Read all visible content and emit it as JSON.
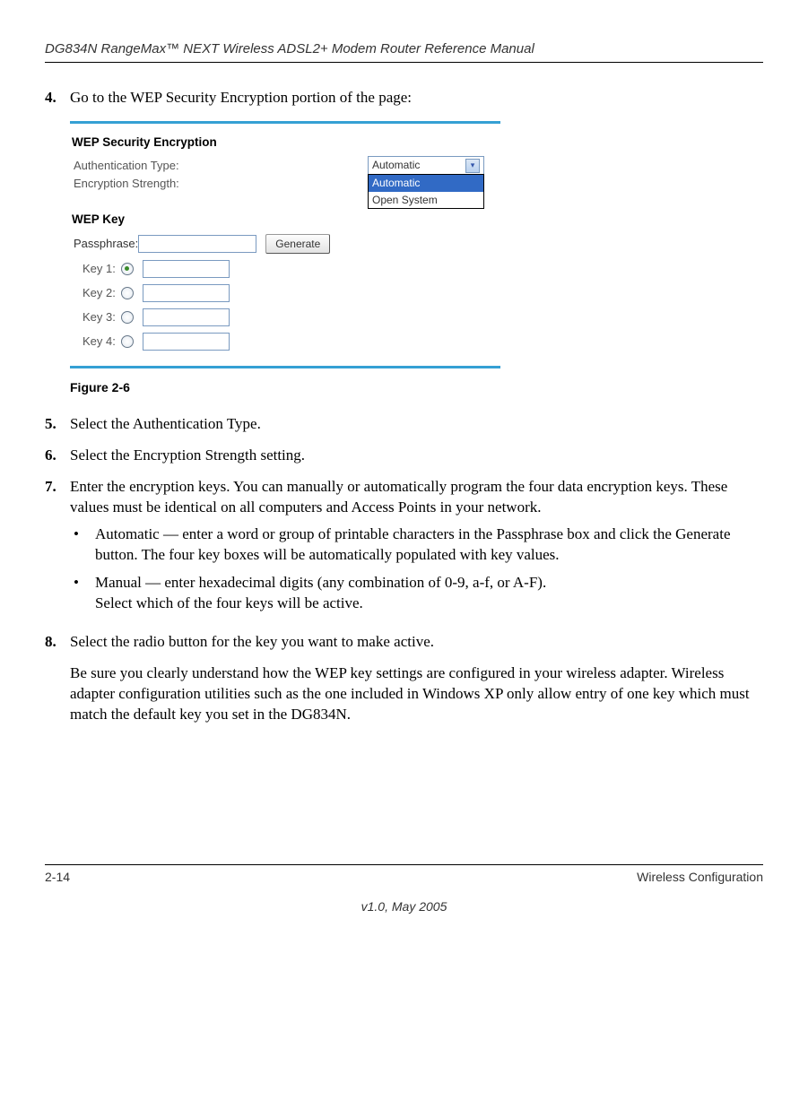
{
  "header": {
    "title": "DG834N RangeMax™ NEXT Wireless ADSL2+ Modem Router Reference Manual"
  },
  "steps": {
    "s4": {
      "num": "4.",
      "text": "Go to the WEP Security Encryption portion of the page:"
    },
    "s5": {
      "num": "5.",
      "text": "Select the Authentication Type."
    },
    "s6": {
      "num": "6.",
      "text": "Select the Encryption Strength setting."
    },
    "s7": {
      "num": "7.",
      "text": "Enter the encryption keys. You can manually or automatically program the four data encryption keys. These values must be identical on all computers and Access Points in your network."
    },
    "s8": {
      "num": "8.",
      "text": "Select the radio button for the key you want to make active."
    }
  },
  "bullets": {
    "b1": "Automatic — enter a word or group of printable characters in the Passphrase box and click the Generate button. The four key boxes will be automatically populated with key values.",
    "b2a": "Manual — enter hexadecimal digits (any combination of 0-9, a-f, or A-F).",
    "b2b": "Select which of the four keys will be active."
  },
  "para8": "Be sure you clearly understand how the WEP key settings are configured in your wireless adapter. Wireless adapter configuration utilities such as the one included in Windows XP only allow entry of one key which must match the default key you set in the DG834N.",
  "figure": {
    "caption": "Figure 2-6",
    "wep_heading": "WEP Security Encryption",
    "auth_label": "Authentication Type:",
    "enc_label": "Encryption Strength:",
    "wepkey_heading": "WEP Key",
    "passphrase_label": "Passphrase: ",
    "generate": "Generate",
    "select_display": "Automatic",
    "opt1": "Automatic",
    "opt2": "Open System",
    "key1": "Key 1: ",
    "key2": "Key 2: ",
    "key3": "Key 3: ",
    "key4": "Key 4: "
  },
  "footer": {
    "left": "2-14",
    "right": "Wireless Configuration",
    "center": "v1.0, May 2005"
  }
}
